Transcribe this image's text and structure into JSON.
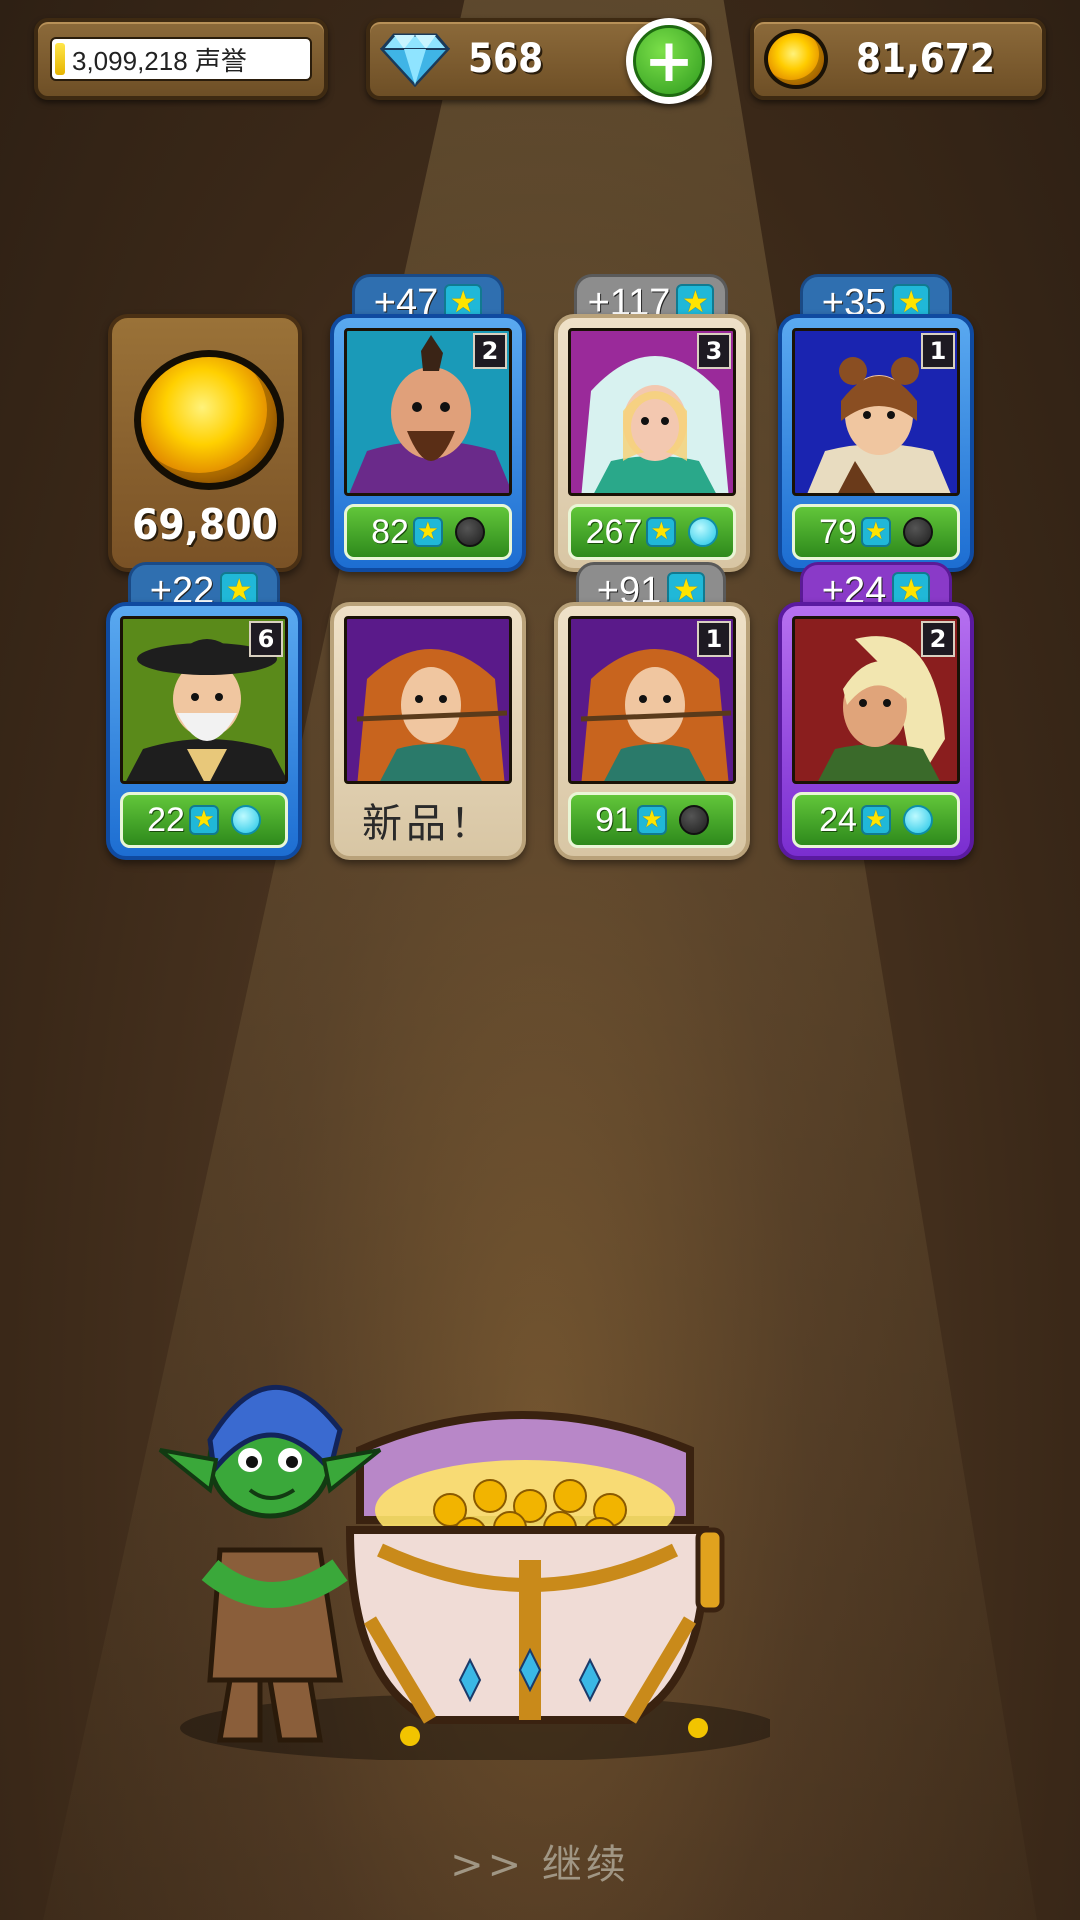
{
  "top_bar": {
    "reputation": "3,099,218 声誉",
    "gems": "568",
    "gold": "81,672"
  },
  "reward": {
    "coin_amount": "69,800"
  },
  "cards": [
    {
      "bonus": "+47",
      "level": "2",
      "stat": "82",
      "rarity": "blue",
      "orb": "dark"
    },
    {
      "bonus": "+117",
      "level": "3",
      "stat": "267",
      "rarity": "tan",
      "orb": "cyan"
    },
    {
      "bonus": "+35",
      "level": "1",
      "stat": "79",
      "rarity": "blue",
      "orb": "dark"
    },
    {
      "bonus": "+22",
      "level": "6",
      "stat": "22",
      "rarity": "blue",
      "orb": "cyan"
    },
    {
      "new_label": "新品！",
      "rarity": "tan"
    },
    {
      "bonus": "+91",
      "level": "1",
      "stat": "91",
      "rarity": "tan",
      "orb": "dark"
    },
    {
      "bonus": "+24",
      "level": "2",
      "stat": "24",
      "rarity": "purple",
      "orb": "cyan"
    }
  ],
  "continue_label": ">> 继续",
  "colors": {
    "rarity_blue": "#1d6ed2",
    "rarity_tan": "#d8c6a4",
    "rarity_purple": "#7a2ed0",
    "stat_green": "#2e8a1c"
  },
  "icons": [
    "diamond-icon",
    "plus-icon",
    "gold-coin-icon",
    "star-icon",
    "orb-icon"
  ]
}
